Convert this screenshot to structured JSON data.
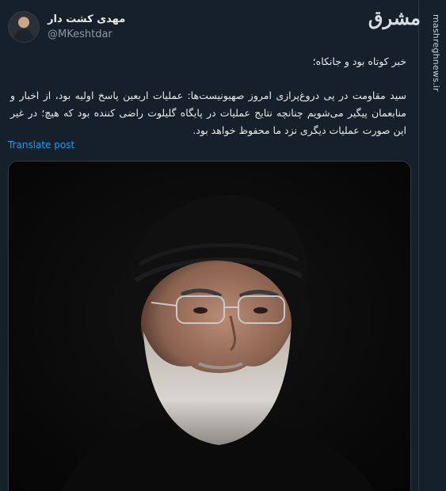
{
  "user": {
    "display_name": "مهدی کشت دار",
    "handle": "@MKeshtdar"
  },
  "watermark": {
    "logo_text": "مشرق",
    "site": "mashreghnews.ir"
  },
  "tweet": {
    "headline": "خبر کوتاه بود و جانکاه؛",
    "body": "سید مقاومت در پی دروغ‌پرازی امروز صهیونیست‌ها: عملیات اربعین پاسخ اولیه بود، از اخبار و منابعمان پیگیر می‌شویم چنانچه نتایج عملیات در پایگاه گلیلوت راضی کننده بود که هیچ؛ در غیر این صورت عملیات دیگری نزد ما محفوظ خواهد بود.",
    "translate_label": "Translate post"
  },
  "media": {
    "alt_subject": "portrait-photo"
  }
}
